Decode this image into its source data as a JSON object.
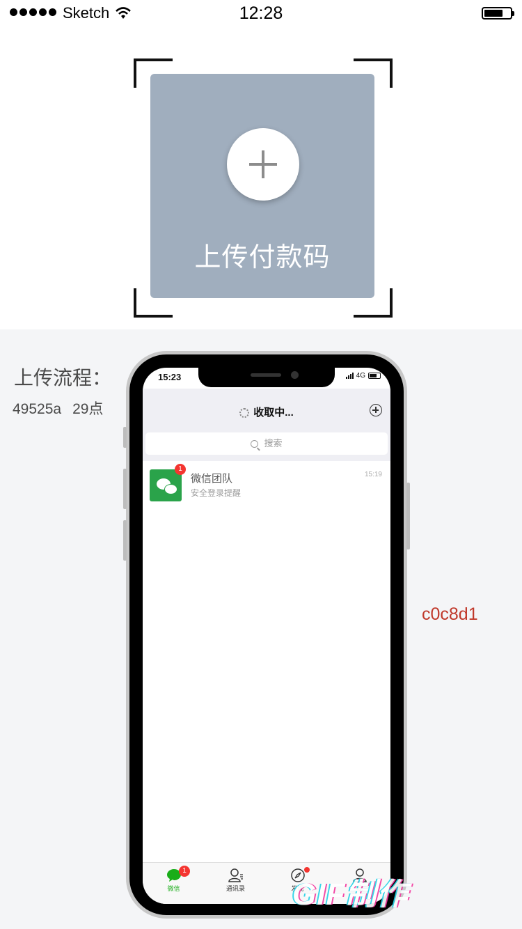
{
  "status_bar": {
    "carrier": "Sketch",
    "time": "12:28",
    "signal_icon": "signal-dots-icon",
    "wifi_icon": "wifi-icon",
    "battery_icon": "battery-icon"
  },
  "upload": {
    "label": "上传付款码",
    "plus_icon": "plus-icon",
    "card_color": "#a0aebe"
  },
  "flow": {
    "title": "上传流程：",
    "meta_color": "49525a",
    "meta_size": "29点",
    "color_note": "c0c8d1"
  },
  "phone": {
    "status_time": "15:23",
    "network": "4G",
    "header_title": "收取中...",
    "search_placeholder": "搜索",
    "chats": [
      {
        "name": "微信团队",
        "subtitle": "安全登录提醒",
        "time": "15:19",
        "badge": "1"
      }
    ],
    "tabs": [
      {
        "label": "微信",
        "icon": "chat-bubble-icon",
        "badge": "1",
        "active": true
      },
      {
        "label": "通讯录",
        "icon": "contacts-icon"
      },
      {
        "label": "发现",
        "icon": "compass-icon",
        "dot": true
      },
      {
        "label": "我",
        "icon": "person-icon"
      }
    ]
  },
  "watermark": "GIF制作",
  "colors": {
    "accent_green": "#1aad19",
    "badge_red": "#f43530",
    "note_red": "#c0392b"
  }
}
